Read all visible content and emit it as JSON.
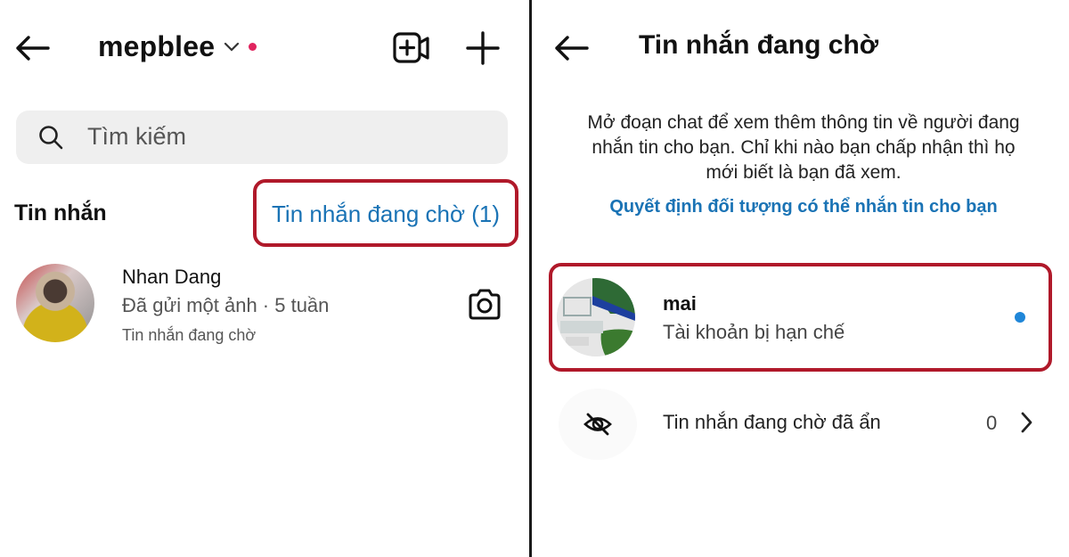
{
  "left": {
    "header": {
      "username": "mepblee",
      "chevron": "⌵",
      "icons": [
        "back-arrow-icon",
        "video-call-icon",
        "plus-icon"
      ]
    },
    "search": {
      "placeholder": "Tìm kiếm",
      "icon": "search-icon"
    },
    "section_title": "Tin nhắn",
    "pending_link": "Tin nhắn đang chờ (1)",
    "chats": [
      {
        "name": "Nhan Dang",
        "preview": "Đã gửi một ảnh · 5 tuần",
        "status": "Tin nhắn đang chờ",
        "icon": "camera-icon"
      }
    ]
  },
  "right": {
    "header": {
      "title": "Tin nhắn đang chờ",
      "icon": "back-arrow-icon"
    },
    "description": "Mở đoạn chat để xem thêm thông tin về người đang nhắn tin cho bạn. Chỉ khi nào bạn chấp nhận thì họ mới biết là bạn đã xem.",
    "link": "Quyết định đối tượng có thể nhắn tin cho bạn",
    "requests": [
      {
        "name": "mai",
        "status": "Tài khoản bị hạn chế",
        "unread": true
      }
    ],
    "hidden_row": {
      "label": "Tin nhắn đang chờ đã ẩn",
      "count": "0",
      "icon": "eye-off-icon"
    }
  },
  "colors": {
    "accent_link": "#1a73b5",
    "highlight_box": "#b0192a",
    "notification_dot": "#e0245e",
    "unread_dot": "#1f86d8"
  }
}
